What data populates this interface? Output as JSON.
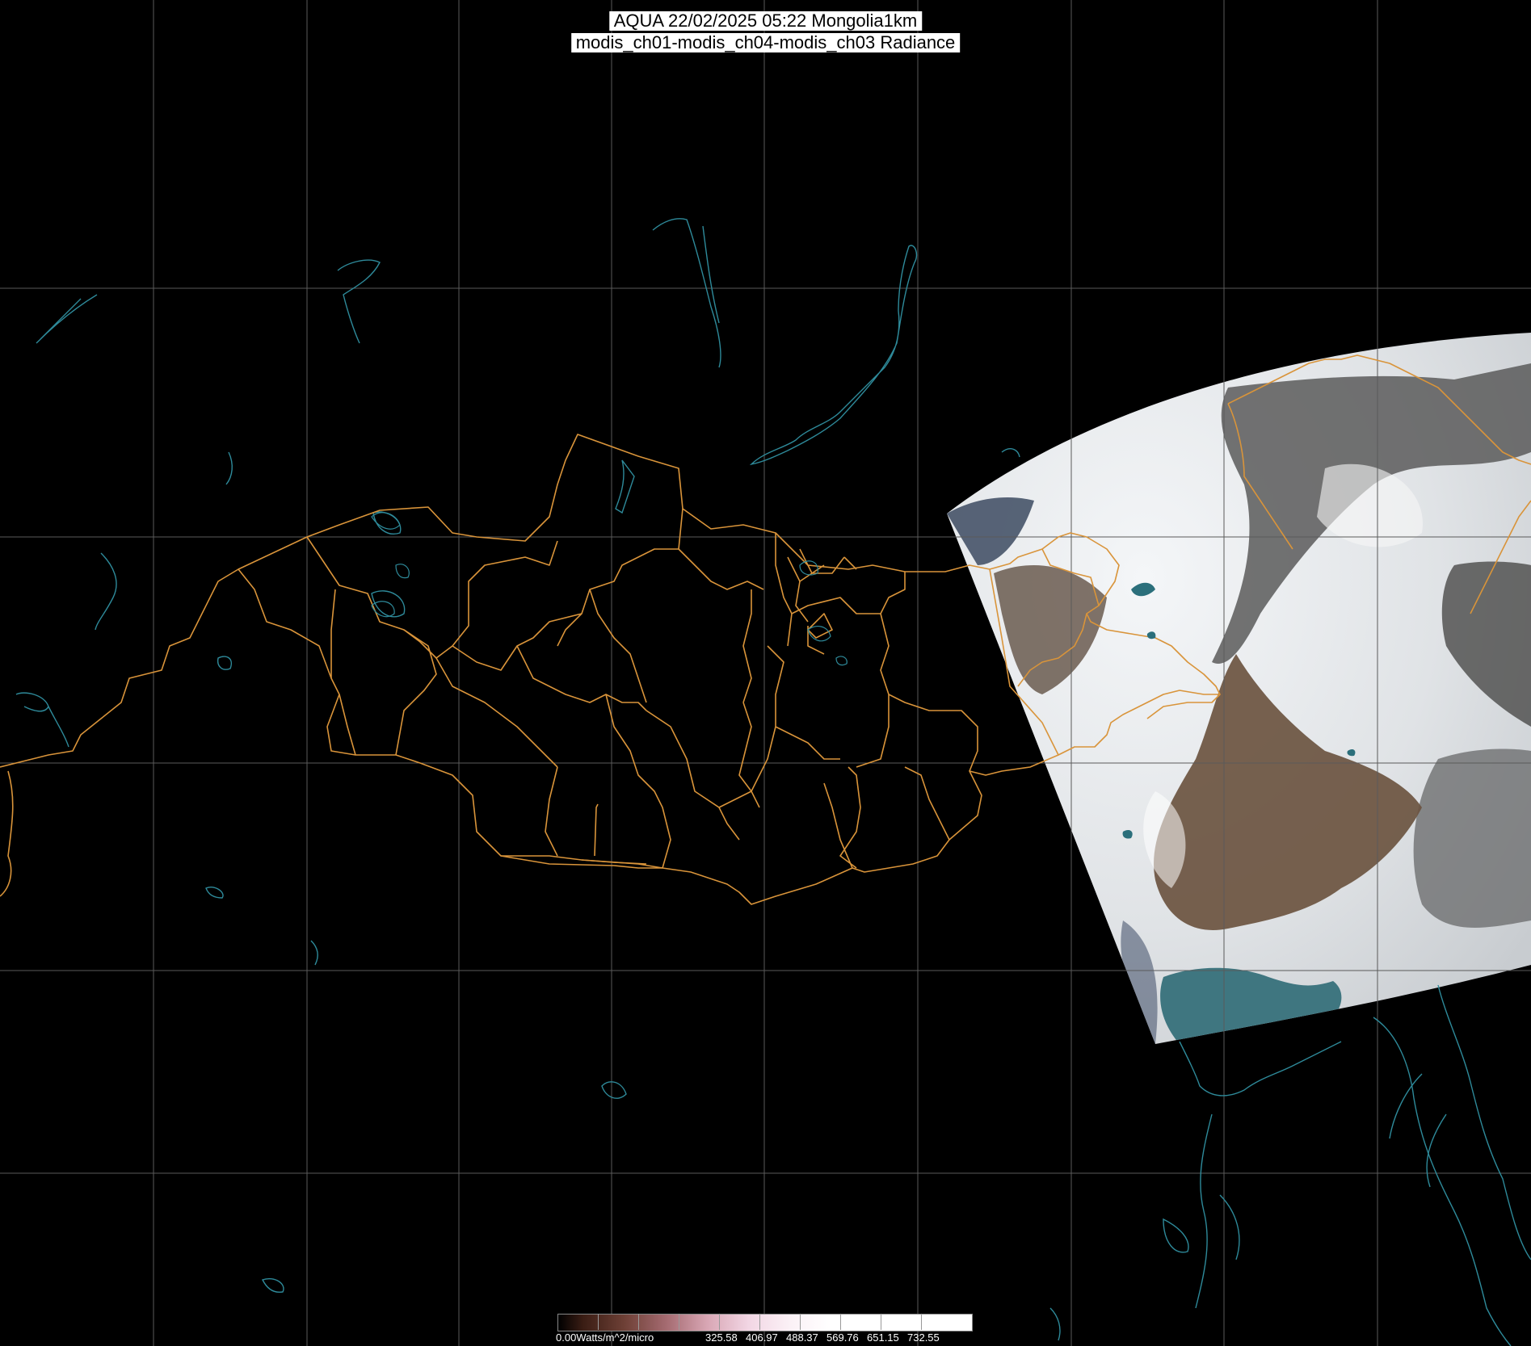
{
  "title": {
    "line1": "AQUA 22/02/2025 05:22 Mongolia1km",
    "line2": "modis_ch01-modis_ch04-modis_ch03 Radiance"
  },
  "colorbar": {
    "labels": [
      "0.00Watts/m^2/micro",
      "325.58",
      "406.97",
      "488.37",
      "569.76",
      "651.15",
      "732.55"
    ]
  },
  "colors": {
    "background": "#000000",
    "grid": "#5a5a5a",
    "boundary": "#d9943a",
    "coast": "#2e8a9a",
    "snow": "#eceff2",
    "bare_ground": "#6b5440",
    "sea": "#3f7680"
  }
}
